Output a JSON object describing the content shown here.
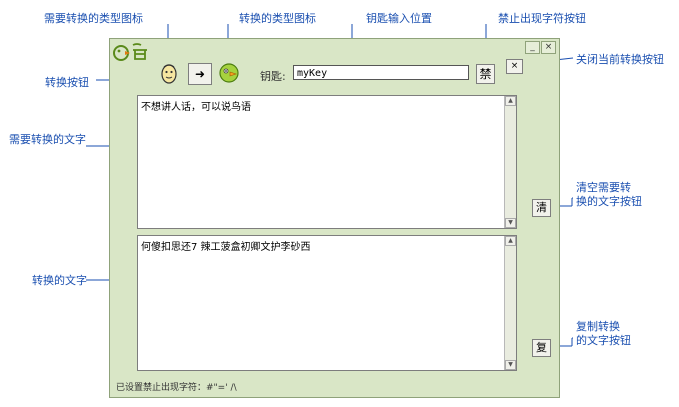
{
  "callouts": {
    "source_type_icon": "需要转换的类型图标",
    "target_type_icon": "转换的类型图标",
    "key_input_location": "钥匙输入位置",
    "ban_char_button": "禁止出现字符按钮",
    "close_conversion_button": "关闭当前转换按钮",
    "convert_button": "转换按钮",
    "source_text": "需要转换的文字",
    "clear_button_line1": "清空需要转",
    "clear_button_line2": "换的文字按钮",
    "converted_text": "转换的文字",
    "copy_button_line1": "复制转换",
    "copy_button_line2": "的文字按钮"
  },
  "window": {
    "minimize": "_",
    "close": "×",
    "convert_arrow": "➜",
    "key_label": "钥匙:",
    "key_value": "myKey",
    "ban_label": "禁",
    "close_conversion": "×",
    "source_text": "不想讲人话，可以说鸟语",
    "converted_text": "何傻扣思还7 辣工菠盒初卿文护李砂西",
    "clear_label": "清",
    "copy_label": "复",
    "status": "已设置禁止出现字符：#\"=' /\\"
  },
  "icons": {
    "logo": "bird-logo-icon",
    "source_type": "human-face-icon",
    "target_type": "bird-face-icon"
  },
  "colors": {
    "accent": "#1a4fb0",
    "window_bg": "#d9e6c6"
  }
}
